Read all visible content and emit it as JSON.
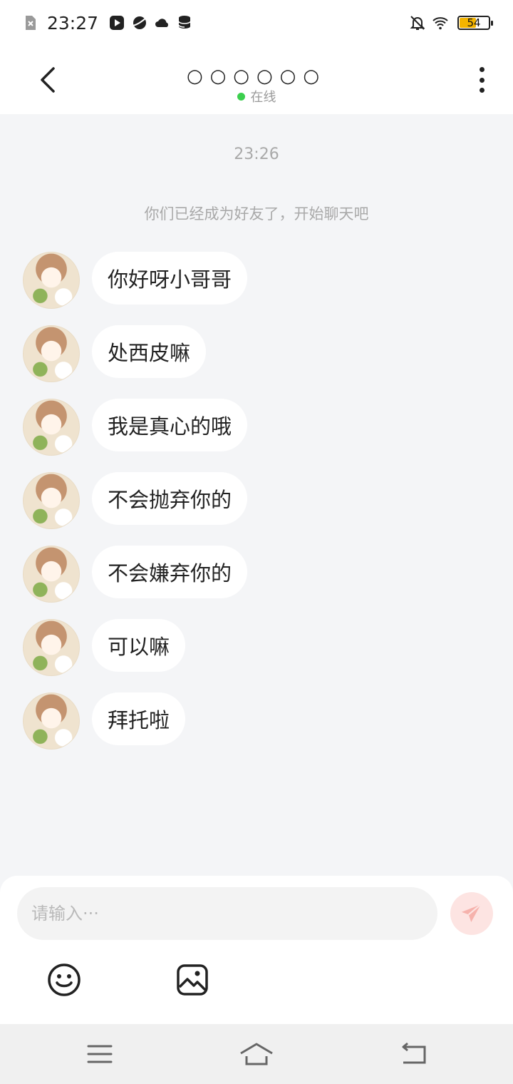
{
  "status_bar": {
    "time": "23:27",
    "battery": "54",
    "left_icons": [
      "sim-off-icon",
      "play-store-icon",
      "planet-icon",
      "cloud-icon",
      "database-icon"
    ],
    "right_icons": [
      "mute-bell-icon",
      "wifi-icon",
      "battery-icon"
    ]
  },
  "header": {
    "title": "○○○○○○",
    "status": "在线",
    "status_color": "#3ccf4e"
  },
  "chat": {
    "timestamp": "23:26",
    "notice": "你们已经成为好友了，开始聊天吧",
    "messages": [
      {
        "text": "你好呀小哥哥"
      },
      {
        "text": "处西皮嘛"
      },
      {
        "text": "我是真心的哦"
      },
      {
        "text": "不会抛弃你的"
      },
      {
        "text": "不会嫌弃你的"
      },
      {
        "text": "可以嘛"
      },
      {
        "text": "拜托啦"
      }
    ]
  },
  "input": {
    "placeholder": "请输入···",
    "value": "",
    "send_color": "#fde4e2"
  },
  "nav_bar": {
    "icons": [
      "menu-icon",
      "home-icon",
      "back-icon"
    ]
  }
}
